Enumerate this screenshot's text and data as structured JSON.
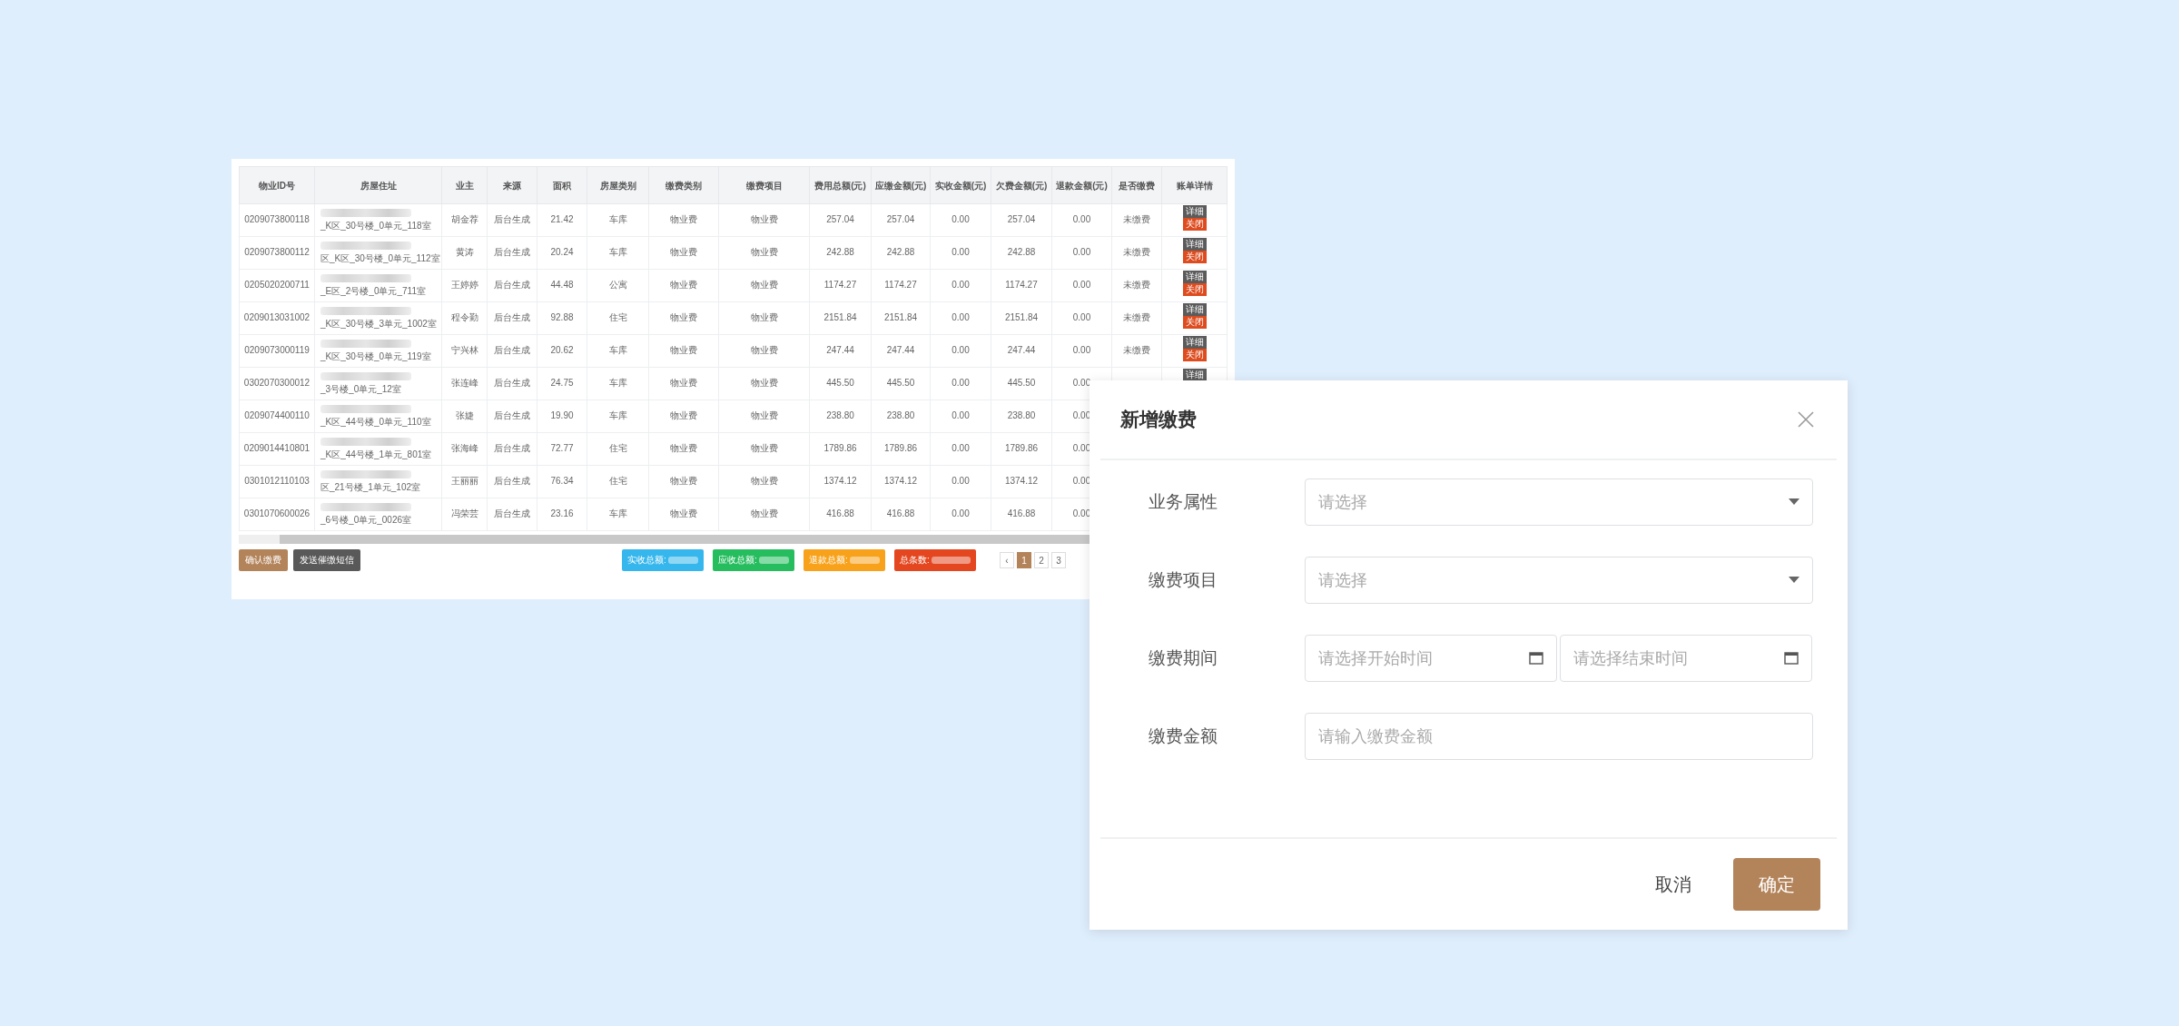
{
  "table": {
    "columns": [
      "物业ID号",
      "房屋住址",
      "业主",
      "来源",
      "面积",
      "房屋类别",
      "缴费类别",
      "缴费项目",
      "费用总额(元)",
      "应缴金额(元)",
      "实收金额(元)",
      "欠费金额(元)",
      "退款金额(元)",
      "是否缴费",
      "账单详情"
    ],
    "rows": [
      {
        "cells": [
          "0209073800118",
          "_K区_30号楼_0单元_118室",
          "胡金荐",
          "后台生成",
          "21.42",
          "车库",
          "物业费",
          "物业费",
          "257.04",
          "257.04",
          "0.00",
          "257.04",
          "0.00",
          "未缴费"
        ],
        "actions": [
          {
            "label": "详细",
            "kind": "detail"
          },
          {
            "label": "关闭",
            "kind": "close"
          }
        ]
      },
      {
        "cells": [
          "0209073800112",
          "区_K区_30号楼_0单元_112室",
          "黄涛",
          "后台生成",
          "20.24",
          "车库",
          "物业费",
          "物业费",
          "242.88",
          "242.88",
          "0.00",
          "242.88",
          "0.00",
          "未缴费"
        ],
        "actions": [
          {
            "label": "详细",
            "kind": "detail"
          },
          {
            "label": "关闭",
            "kind": "close"
          }
        ]
      },
      {
        "cells": [
          "0205020200711",
          "_E区_2号楼_0单元_711室",
          "王婷婷",
          "后台生成",
          "44.48",
          "公寓",
          "物业费",
          "物业费",
          "1174.27",
          "1174.27",
          "0.00",
          "1174.27",
          "0.00",
          "未缴费"
        ],
        "actions": [
          {
            "label": "详细",
            "kind": "detail"
          },
          {
            "label": "关闭",
            "kind": "close"
          }
        ]
      },
      {
        "cells": [
          "0209013031002",
          "_K区_30号楼_3单元_1002室",
          "程令勤",
          "后台生成",
          "92.88",
          "住宅",
          "物业费",
          "物业费",
          "2151.84",
          "2151.84",
          "0.00",
          "2151.84",
          "0.00",
          "未缴费"
        ],
        "actions": [
          {
            "label": "详细",
            "kind": "detail"
          },
          {
            "label": "关闭",
            "kind": "close"
          }
        ]
      },
      {
        "cells": [
          "0209073000119",
          "_K区_30号楼_0单元_119室",
          "宁兴林",
          "后台生成",
          "20.62",
          "车库",
          "物业费",
          "物业费",
          "247.44",
          "247.44",
          "0.00",
          "247.44",
          "0.00",
          "未缴费"
        ],
        "actions": [
          {
            "label": "详细",
            "kind": "detail"
          },
          {
            "label": "关闭",
            "kind": "close"
          }
        ]
      },
      {
        "cells": [
          "0302070300012",
          "_3号楼_0单元_12室",
          "张连峰",
          "后台生成",
          "24.75",
          "车库",
          "物业费",
          "物业费",
          "445.50",
          "445.50",
          "0.00",
          "445.50",
          "0.00"
        ],
        "actions": [
          {
            "label": "详细",
            "kind": "detail"
          }
        ]
      },
      {
        "cells": [
          "0209074400110",
          "_K区_44号楼_0单元_110室",
          "张婕",
          "后台生成",
          "19.90",
          "车库",
          "物业费",
          "物业费",
          "238.80",
          "238.80",
          "0.00",
          "238.80",
          "0.00"
        ],
        "actions": []
      },
      {
        "cells": [
          "0209014410801",
          "_K区_44号楼_1单元_801室",
          "张海峰",
          "后台生成",
          "72.77",
          "住宅",
          "物业费",
          "物业费",
          "1789.86",
          "1789.86",
          "0.00",
          "1789.86",
          "0.00"
        ],
        "actions": []
      },
      {
        "cells": [
          "0301012110103",
          "区_21号楼_1单元_102室",
          "王丽丽",
          "后台生成",
          "76.34",
          "住宅",
          "物业费",
          "物业费",
          "1374.12",
          "1374.12",
          "0.00",
          "1374.12",
          "0.00"
        ],
        "actions": []
      },
      {
        "cells": [
          "0301070600026",
          "_6号楼_0单元_0026室",
          "冯荣芸",
          "后台生成",
          "23.16",
          "车库",
          "物业费",
          "物业费",
          "416.88",
          "416.88",
          "0.00",
          "416.88",
          "0.00"
        ],
        "actions": []
      }
    ]
  },
  "footer": {
    "buttons": [
      {
        "label": "确认缴费",
        "kind": "confirm"
      },
      {
        "label": "发送催缴短信",
        "kind": "send"
      }
    ],
    "totals": [
      {
        "label": "实收总额:",
        "color": "#35b6ec"
      },
      {
        "label": "应收总额:",
        "color": "#26bd5f"
      },
      {
        "label": "退款总额:",
        "color": "#f7a21a"
      },
      {
        "label": "总条数:",
        "color": "#e4461f"
      }
    ],
    "pagination": [
      {
        "label": "‹",
        "selected": false
      },
      {
        "label": "1",
        "selected": true
      },
      {
        "label": "2",
        "selected": false
      },
      {
        "label": "3",
        "selected": false
      }
    ]
  },
  "dialog": {
    "title": "新增缴费",
    "fields": [
      {
        "label": "业务属性",
        "kind": "select",
        "placeholder": "请选择"
      },
      {
        "label": "缴费项目",
        "kind": "select",
        "placeholder": "请选择"
      },
      {
        "label": "缴费期间",
        "kind": "date_range",
        "placeholders": [
          "请选择开始时间",
          "请选择结束时间"
        ]
      },
      {
        "label": "缴费金额",
        "kind": "input",
        "placeholder": "请输入缴费金额"
      }
    ],
    "buttons": [
      {
        "label": "取消",
        "kind": "cancel"
      },
      {
        "label": "确定",
        "kind": "primary"
      }
    ]
  }
}
